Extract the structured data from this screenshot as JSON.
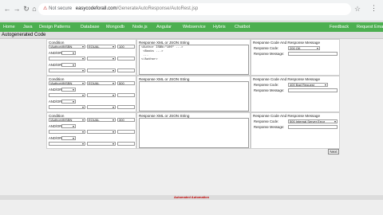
{
  "browser": {
    "security_label": "Not secure",
    "url_host": "easycodeforall.com",
    "url_path": "/GenerateAutoResponse/AutoRest.jsp"
  },
  "nav": {
    "items": [
      "Home",
      "Java",
      "Design Patterns",
      "Database",
      "Mongodb",
      "Node.js",
      "Angular",
      "Webservice",
      "Hybris",
      "Chatbot",
      "Feedback",
      "Request Email"
    ]
  },
  "page": {
    "title": "Autogenerated Code"
  },
  "headers": {
    "condition": "Condition",
    "xml": "Response XML or JSON String",
    "response": "Response Code And Response Message",
    "response_code_label": "Response Code:",
    "response_message_label": "Response Message:"
  },
  "conditions": [
    {
      "field": "/Author/@ISBN",
      "operator": "EQUAL",
      "value": "100",
      "connectors": [
        "AND/OR:",
        "AND/OR:",
        "AND/OR:"
      ]
    },
    {
      "field": "/Author/@ISBN",
      "operator": "EQUAL",
      "value": "500",
      "connectors": [
        "AND/OR:",
        "AND/OR:",
        "AND/OR:"
      ]
    },
    {
      "field": "/Author/@ISBN",
      "operator": "EQUAL",
      "value": "300",
      "connectors": [
        "AND/OR:",
        "AND/OR:",
        "AND/OR:"
      ]
    }
  ],
  "xml_values": [
    "<Author ISBN=\"100\" ...>\n <Books ...>\n ...\n</Author>",
    "",
    ""
  ],
  "responses": [
    {
      "code": "200 OK",
      "message": ""
    },
    {
      "code": "400 Bad Request",
      "message": ""
    },
    {
      "code": "500 Internal Server Error",
      "message": ""
    }
  ],
  "next_label": "Next",
  "footer": {
    "text": "Automated Automation"
  },
  "colors": {
    "nav_bg": "#4caf50",
    "footer_text": "#c00000"
  },
  "icons": [
    "back-icon",
    "forward-icon",
    "reload-icon",
    "home-icon",
    "warning-icon",
    "star-icon",
    "kebab-icon"
  ]
}
